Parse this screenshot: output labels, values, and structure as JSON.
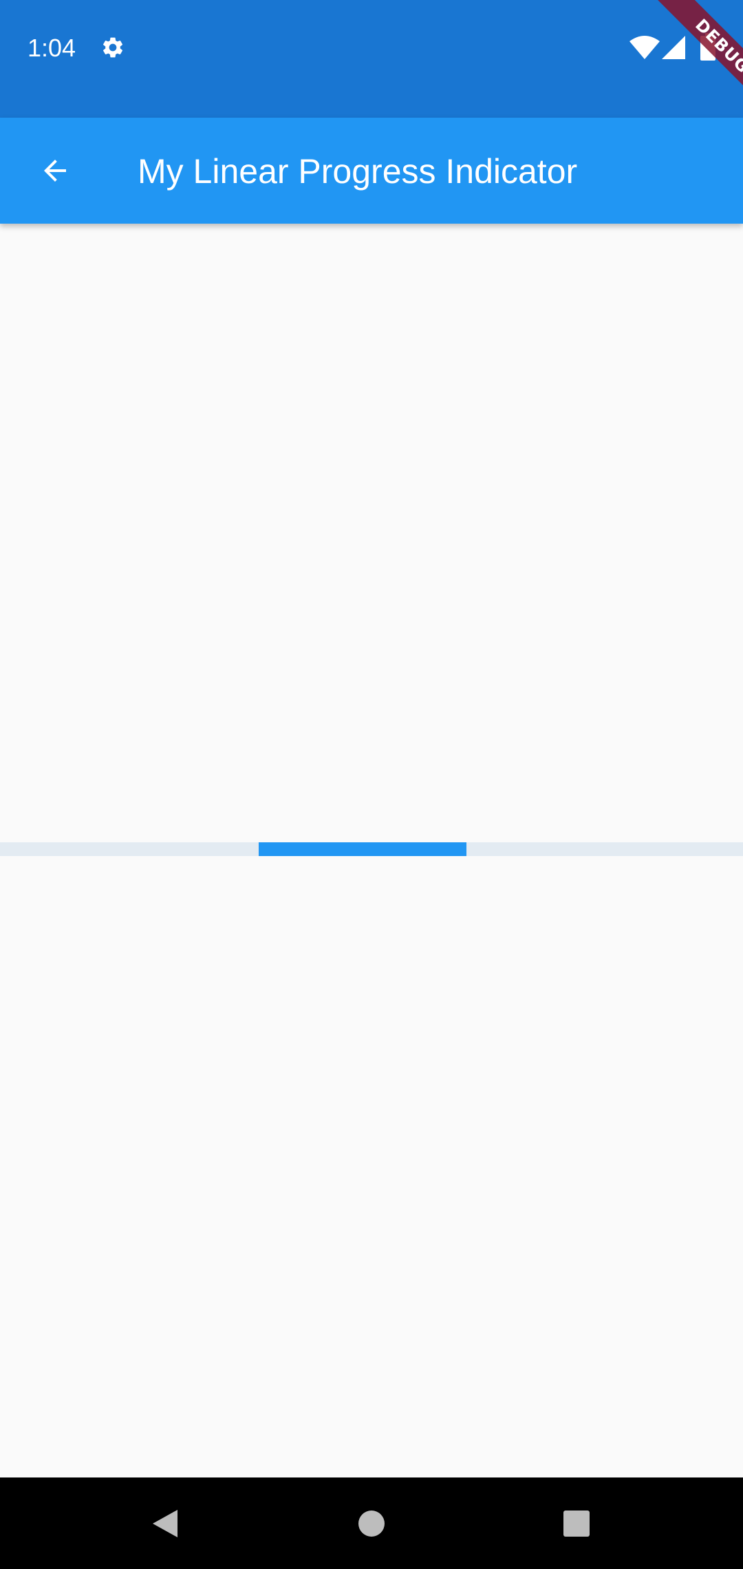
{
  "status_bar": {
    "time": "1:04",
    "icons": [
      "gear-icon",
      "wifi-icon",
      "signal-icon",
      "battery-icon"
    ],
    "background_color": "#1976d2"
  },
  "debug_banner": {
    "label": "DEBUG",
    "color": "#87142d"
  },
  "app_bar": {
    "title": "My Linear Progress Indicator",
    "back_icon": "arrow-back-icon",
    "background_color": "#2196f3"
  },
  "progress": {
    "type": "indeterminate-linear",
    "segment_start": 0.348,
    "segment_end": 0.628,
    "track_color": "#e3ebf2",
    "fill_color": "#2196f3"
  },
  "nav_bar": {
    "buttons": [
      "back-triangle-icon",
      "home-circle-icon",
      "recents-square-icon"
    ]
  }
}
